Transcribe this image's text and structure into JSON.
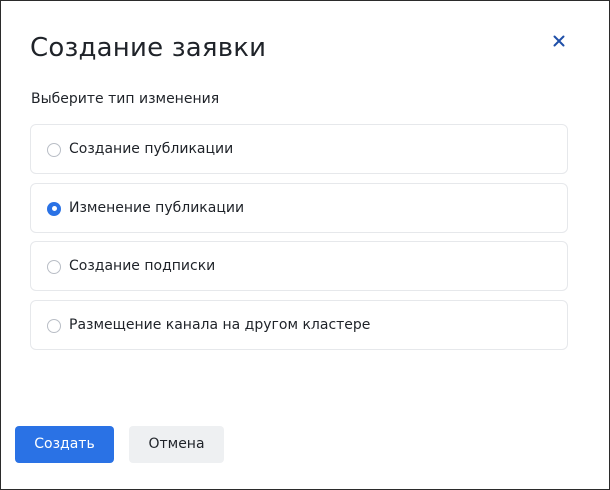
{
  "dialog": {
    "title": "Создание заявки",
    "close_icon": "close-icon",
    "section_label": "Выберите тип изменения",
    "options": [
      {
        "label": "Создание публикации",
        "checked": false
      },
      {
        "label": "Изменение публикации",
        "checked": true
      },
      {
        "label": "Создание подписки",
        "checked": false
      },
      {
        "label": "Размещение канала на другом кластере",
        "checked": false
      }
    ],
    "buttons": {
      "create_label": "Создать",
      "cancel_label": "Отмена"
    },
    "colors": {
      "accent": "#2a72e5",
      "close_icon": "#1f4fa8",
      "secondary_bg": "#eef0f2",
      "option_border": "#e6e8eb"
    }
  }
}
